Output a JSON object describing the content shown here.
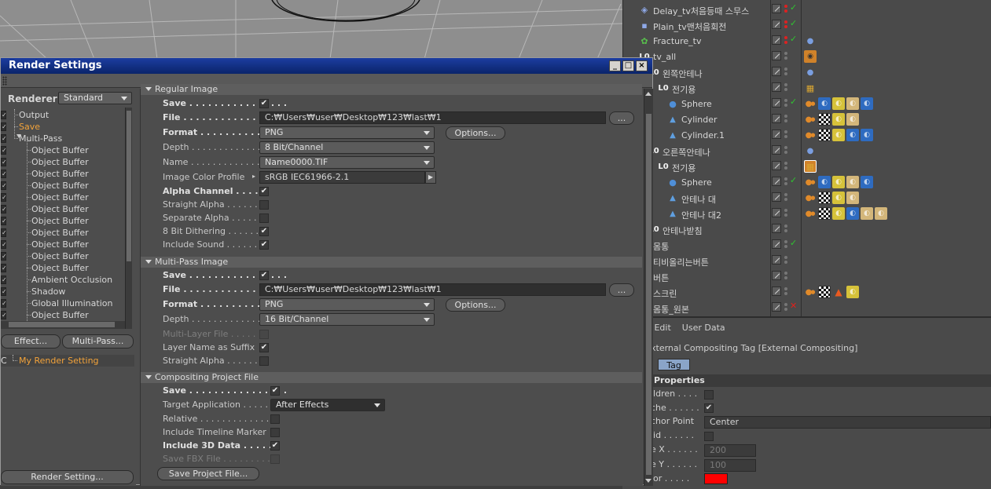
{
  "objects": [
    {
      "name": "Delay_tv처음등때 스무스",
      "icon": "deformer-icon",
      "status": "check",
      "tags": []
    },
    {
      "name": "Plain_tv맨처음회전",
      "icon": "effector-icon",
      "status": "check",
      "tags": []
    },
    {
      "name": "Fracture_tv",
      "icon": "fracture-icon",
      "status": "check",
      "tags": [
        "sphere-tag-icon"
      ]
    },
    {
      "name": "tv_all",
      "icon": "null-icon",
      "status": "none",
      "tags": [
        "target-tag-icon"
      ]
    },
    {
      "name": "왼쪽안테나",
      "icon": "null-icon",
      "status": "none",
      "tags": [
        "sphere-tag-icon"
      ]
    },
    {
      "name": "전기용",
      "icon": "null-icon",
      "status": "none",
      "tags": [
        "clapper-tag-icon"
      ]
    },
    {
      "name": "Sphere",
      "icon": "sphere-icon",
      "status": "check",
      "tags": [
        "phong-tag-icon",
        "material-blue-icon",
        "material-yellow-icon",
        "material-tan-icon",
        "material-blue-icon"
      ]
    },
    {
      "name": "Cylinder",
      "icon": "cylinder-icon",
      "status": "none",
      "tags": [
        "phong-tag-icon",
        "checker-tag-icon",
        "material-yellow-icon",
        "material-tan-icon"
      ]
    },
    {
      "name": "Cylinder.1",
      "icon": "cylinder-icon",
      "status": "none",
      "tags": [
        "phong-tag-icon",
        "checker-tag-icon",
        "material-yellow-icon",
        "material-blue-icon",
        "material-blue-icon"
      ]
    },
    {
      "name": "오른쪽안테나",
      "icon": "null-icon",
      "status": "none",
      "tags": [
        "sphere-tag-icon"
      ]
    },
    {
      "name": "전기용",
      "icon": "null-icon",
      "status": "none",
      "tags": [
        "clapper-selected-tag-icon"
      ]
    },
    {
      "name": "Sphere",
      "icon": "sphere-icon",
      "status": "check",
      "tags": [
        "phong-tag-icon",
        "material-blue-icon",
        "material-yellow-icon",
        "material-tan-icon",
        "material-blue-icon"
      ]
    },
    {
      "name": "안테나 대",
      "icon": "cylinder-icon",
      "status": "none",
      "tags": [
        "phong-tag-icon",
        "checker-tag-icon",
        "material-yellow-icon",
        "material-tan-icon"
      ]
    },
    {
      "name": "안테나 대2",
      "icon": "cylinder-icon",
      "status": "none",
      "tags": [
        "phong-tag-icon",
        "checker-tag-icon",
        "material-yellow-icon",
        "material-blue-icon",
        "material-tan-icon",
        "material-tan-icon"
      ]
    },
    {
      "name": "안테나받침",
      "icon": "null-icon",
      "status": "none",
      "tags": []
    },
    {
      "name": "몸통",
      "icon": "capsule-icon",
      "status": "check",
      "tags": []
    },
    {
      "name": "티비올리는버튼",
      "icon": "null-icon",
      "status": "none",
      "tags": []
    },
    {
      "name": "버튼",
      "icon": "null-icon",
      "status": "none",
      "tags": []
    },
    {
      "name": "스크린",
      "icon": "cylinder-icon",
      "status": "none",
      "tags": [
        "phong-tag-icon",
        "checker-tag-icon",
        "cone-tag-icon",
        "material-yellow-icon"
      ]
    },
    {
      "name": "몸통_원본",
      "icon": "capsule-icon",
      "status": "x",
      "tags": []
    }
  ],
  "attr": {
    "menu": [
      "ode",
      "Edit",
      "User Data"
    ],
    "title": "xternal Compositing Tag [External Compositing]",
    "tab": "Tag",
    "props_title": "Properties",
    "rows": [
      {
        "label": "ildren . . . .",
        "type": "checkbox",
        "checked": false
      },
      {
        "label": "che . . . . . .",
        "type": "checkbox",
        "checked": true
      },
      {
        "label": "chor Point",
        "type": "field",
        "value": "Center"
      },
      {
        "label": "lid . . . . . .",
        "type": "checkbox",
        "checked": false
      },
      {
        "label": "e X . . . . . .",
        "type": "number",
        "value": "200"
      },
      {
        "label": "e Y . . . . . .",
        "type": "number",
        "value": "100"
      },
      {
        "label": "lor . . . . .",
        "type": "color",
        "value": "#ff0000"
      }
    ]
  },
  "render": {
    "title": "Render Settings",
    "renderer_label": "Renderer",
    "renderer_value": "Standard",
    "tree": [
      {
        "label": "Output",
        "indent": 1,
        "selected": false
      },
      {
        "label": "Save",
        "indent": 1,
        "selected": true
      },
      {
        "label": "Multi-Pass",
        "indent": 1,
        "selected": false
      },
      {
        "label": "Object Buffer",
        "indent": 2,
        "selected": false
      },
      {
        "label": "Object Buffer",
        "indent": 2,
        "selected": false
      },
      {
        "label": "Object Buffer",
        "indent": 2,
        "selected": false
      },
      {
        "label": "Object Buffer",
        "indent": 2,
        "selected": false
      },
      {
        "label": "Object Buffer",
        "indent": 2,
        "selected": false
      },
      {
        "label": "Object Buffer",
        "indent": 2,
        "selected": false
      },
      {
        "label": "Object Buffer",
        "indent": 2,
        "selected": false
      },
      {
        "label": "Object Buffer",
        "indent": 2,
        "selected": false
      },
      {
        "label": "Object Buffer",
        "indent": 2,
        "selected": false
      },
      {
        "label": "Object Buffer",
        "indent": 2,
        "selected": false
      },
      {
        "label": "Object Buffer",
        "indent": 2,
        "selected": false
      },
      {
        "label": "Ambient Occlusion",
        "indent": 2,
        "selected": false
      },
      {
        "label": "Shadow",
        "indent": 2,
        "selected": false
      },
      {
        "label": "Global Illumination",
        "indent": 2,
        "selected": false
      },
      {
        "label": "Object Buffer",
        "indent": 2,
        "selected": false
      }
    ],
    "effect_btn": "Effect...",
    "multipass_btn": "Multi-Pass...",
    "setting_name": "My Render Setting",
    "render_setting_btn": "Render Setting...",
    "regular": {
      "section": "Regular Image",
      "save_label": "Save . . . . . . . . . . . . . . . .",
      "file_label": "File . . . . . . . . . . . . . . . . .",
      "file_value": "C:₩Users₩user₩Desktop₩123₩last₩1",
      "browse_btn": "...",
      "format_label": "Format . . . . . . . . . . . . .",
      "format_value": "PNG",
      "options_btn": "Options...",
      "depth_label": "Depth . . . . . . . . . . . . . . . . .",
      "depth_value": "8 Bit/Channel",
      "name_label": "Name . . . . . . . . . . . . . . . . .",
      "name_value": "Name0000.TIF",
      "profile_label": "Image Color Profile",
      "profile_value": "sRGB IEC61966-2.1",
      "alpha_label": "Alpha Channel . . . .",
      "straight_label": "Straight Alpha . . . . . . . .",
      "separate_label": "Separate Alpha . . . . . . .",
      "dither_label": "8 Bit Dithering . . . . . . . .",
      "sound_label": "Include Sound . . . . . . . ."
    },
    "multipass": {
      "section": "Multi-Pass Image",
      "save_label": "Save . . . . . . . . . . . . . . . .",
      "file_label": "File . . . . . . . . . . . . . . . . .",
      "file_value": "C:₩Users₩user₩Desktop₩123₩last₩1",
      "browse_btn": "...",
      "format_label": "Format . . . . . . . . . . . . .",
      "format_value": "PNG",
      "options_btn": "Options...",
      "depth_label": "Depth . . . . . . . . . . . . . . . . .",
      "depth_value": "16 Bit/Channel",
      "multilayer_label": "Multi-Layer File . . . . . .",
      "suffix_label": "Layer Name as Suffix",
      "straight_label": "Straight Alpha . . . . . . . ."
    },
    "compositing": {
      "section": "Compositing Project File",
      "save_label": "Save . . . . . . . . . . . . . . . .",
      "target_label": "Target Application . . . . .",
      "target_value": "After Effects",
      "relative_label": "Relative . . . . . . . . . . . . . . .",
      "timeline_label": "Include Timeline Marker",
      "data3d_label": "Include 3D Data . . . . .",
      "fbx_label": "Save FBX File . . . . . . . . .",
      "save_project_btn": "Save Project File..."
    }
  }
}
